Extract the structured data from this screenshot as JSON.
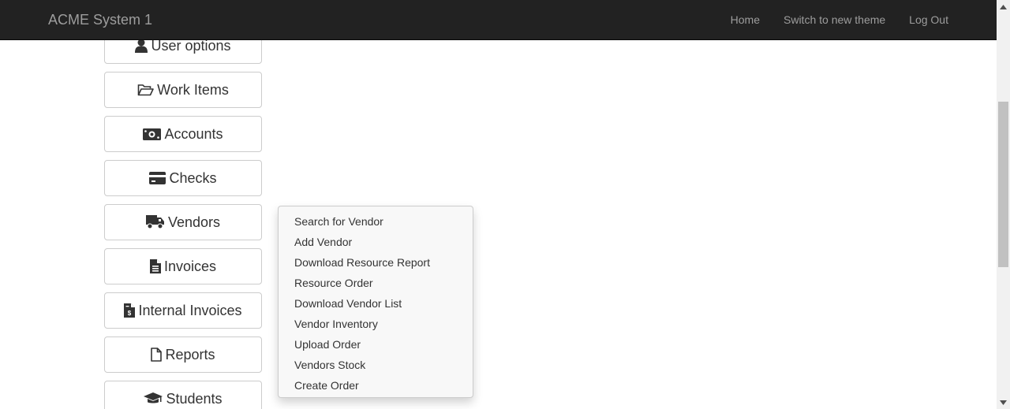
{
  "navbar": {
    "brand": "ACME System 1",
    "links": [
      "Home",
      "Switch to new theme",
      "Log Out"
    ]
  },
  "sidebar": {
    "buttons": [
      {
        "label": "User options",
        "icon": "user-icon"
      },
      {
        "label": "Work Items",
        "icon": "folder-open-icon"
      },
      {
        "label": "Accounts",
        "icon": "money-icon"
      },
      {
        "label": "Checks",
        "icon": "credit-card-icon"
      },
      {
        "label": "Vendors",
        "icon": "truck-icon"
      },
      {
        "label": "Invoices",
        "icon": "file-text-icon"
      },
      {
        "label": "Internal Invoices",
        "icon": "file-invoice-dollar-icon"
      },
      {
        "label": "Reports",
        "icon": "file-icon"
      },
      {
        "label": "Students",
        "icon": "graduation-cap-icon"
      }
    ]
  },
  "vendors_menu": {
    "items": [
      "Search for Vendor",
      "Add Vendor",
      "Download Resource Report",
      "Resource Order",
      "Download Vendor List",
      "Vendor Inventory",
      "Upload Order",
      "Vendors Stock",
      "Create Order"
    ]
  },
  "colors": {
    "navbar_bg": "#222222",
    "navbar_text": "#9d9d9d",
    "button_border": "#cccccc",
    "dropdown_bg": "#f8f8f8"
  }
}
